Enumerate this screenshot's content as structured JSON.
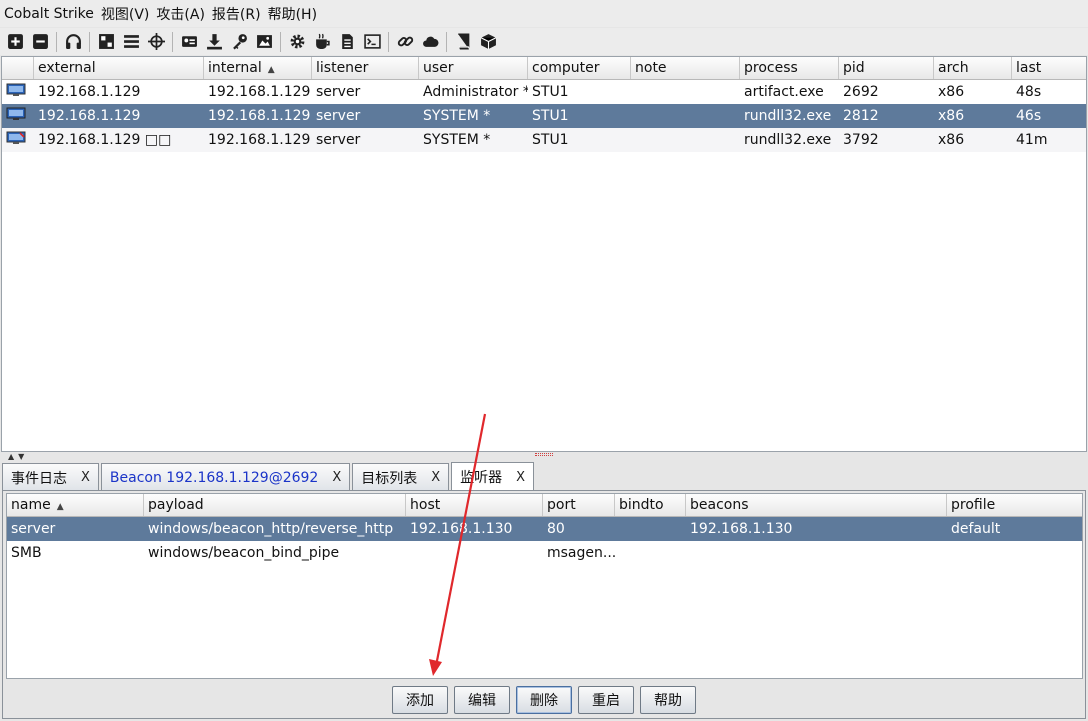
{
  "menu": {
    "app": "Cobalt Strike",
    "items": [
      "视图(V)",
      "攻击(A)",
      "报告(R)",
      "帮助(H)"
    ]
  },
  "toolbar": {
    "icons": [
      "add-icon",
      "remove-icon",
      "headphones-icon",
      "pivot-graph-icon",
      "session-list-icon",
      "target-crosshair-icon",
      "credentials-icon",
      "download-icon",
      "key-icon",
      "screenshot-icon",
      "gear-icon",
      "coffee-icon",
      "document-icon",
      "console-icon",
      "link-icon",
      "cloud-icon",
      "book-icon",
      "cube-icon"
    ]
  },
  "sessions": {
    "columns": [
      "external",
      "internal",
      "listener",
      "user",
      "computer",
      "note",
      "process",
      "pid",
      "arch",
      "last"
    ],
    "sorted_column": "internal",
    "rows": [
      {
        "external": "192.168.1.129",
        "internal": "192.168.1.129",
        "listener": "server",
        "user": "Administrator *",
        "computer": "STU1",
        "note": "",
        "process": "artifact.exe",
        "pid": "2692",
        "arch": "x86",
        "last": "48s"
      },
      {
        "external": "192.168.1.129",
        "internal": "192.168.1.129",
        "listener": "server",
        "user": "SYSTEM *",
        "computer": "STU1",
        "note": "",
        "process": "rundll32.exe",
        "pid": "2812",
        "arch": "x86",
        "last": "46s"
      },
      {
        "external": "192.168.1.129 □□",
        "internal": "192.168.1.129",
        "listener": "server",
        "user": "SYSTEM *",
        "computer": "STU1",
        "note": "",
        "process": "rundll32.exe",
        "pid": "3792",
        "arch": "x86",
        "last": "41m"
      }
    ],
    "selected_row": 1
  },
  "tabs": [
    {
      "label": "事件日志",
      "close": "X",
      "blue": false
    },
    {
      "label": "Beacon 192.168.1.129@2692",
      "close": "X",
      "blue": true
    },
    {
      "label": "目标列表",
      "close": "X",
      "blue": false
    },
    {
      "label": "监听器",
      "close": "X",
      "blue": false
    }
  ],
  "active_tab": 3,
  "listeners": {
    "columns": [
      "name",
      "payload",
      "host",
      "port",
      "bindto",
      "beacons",
      "profile"
    ],
    "sorted_column": "name",
    "rows": [
      {
        "name": "server",
        "payload": "windows/beacon_http/reverse_http",
        "host": "192.168.1.130",
        "port": "80",
        "bindto": "",
        "beacons": "192.168.1.130",
        "profile": "default"
      },
      {
        "name": "SMB",
        "payload": "windows/beacon_bind_pipe",
        "host": "",
        "port": "msagen...",
        "bindto": "",
        "beacons": "",
        "profile": ""
      }
    ],
    "selected_row": 0
  },
  "buttons": {
    "add": "添加",
    "edit": "编辑",
    "delete": "删除",
    "restart": "重启",
    "help": "帮助"
  },
  "colors": {
    "selection": "#5e7a9b",
    "annotation_arrow": "#e0282c",
    "tab_highlight": "#1b34c8"
  }
}
